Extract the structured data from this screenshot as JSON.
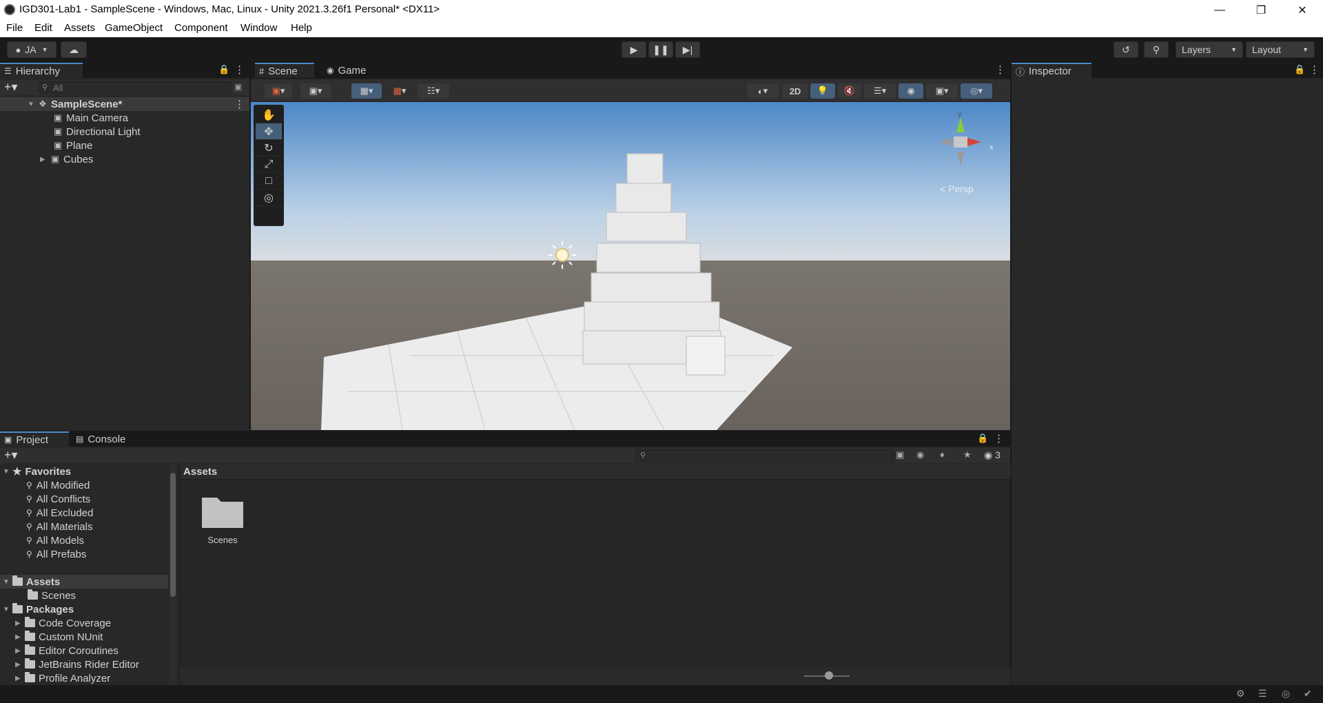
{
  "window": {
    "title": "IGD301-Lab1 - SampleScene - Windows, Mac, Linux - Unity 2021.3.26f1 Personal* <DX11>"
  },
  "menu": [
    "File",
    "Edit",
    "Assets",
    "GameObject",
    "Component",
    "Window",
    "Help"
  ],
  "toolbar": {
    "account": "JA",
    "layers": "Layers",
    "layout": "Layout"
  },
  "hierarchy": {
    "tab": "Hierarchy",
    "search_placeholder": "All",
    "scene": "SampleScene*",
    "items": [
      "Main Camera",
      "Directional Light",
      "Plane",
      "Cubes"
    ]
  },
  "scene_tabs": {
    "scene": "Scene",
    "game": "Game"
  },
  "scene_toolbar": {
    "mode_2d": "2D"
  },
  "gizmo": {
    "y": "y",
    "x": "x",
    "persp": "< Persp"
  },
  "inspector": {
    "tab": "Inspector"
  },
  "project": {
    "tabs": {
      "project": "Project",
      "console": "Console"
    },
    "hidden_count": "3",
    "favorites_label": "Favorites",
    "favorites": [
      "All Modified",
      "All Conflicts",
      "All Excluded",
      "All Materials",
      "All Models",
      "All Prefabs"
    ],
    "assets_label": "Assets",
    "assets_children": [
      "Scenes"
    ],
    "packages_label": "Packages",
    "packages": [
      "Code Coverage",
      "Custom NUnit",
      "Editor Coroutines",
      "JetBrains Rider Editor",
      "Profile Analyzer"
    ],
    "breadcrumb": "Assets",
    "grid_items": [
      {
        "name": "Scenes",
        "icon": "folder-icon"
      }
    ]
  },
  "colors": {
    "accent": "#4a8ad0",
    "panel": "#282828",
    "bg": "#191919"
  }
}
